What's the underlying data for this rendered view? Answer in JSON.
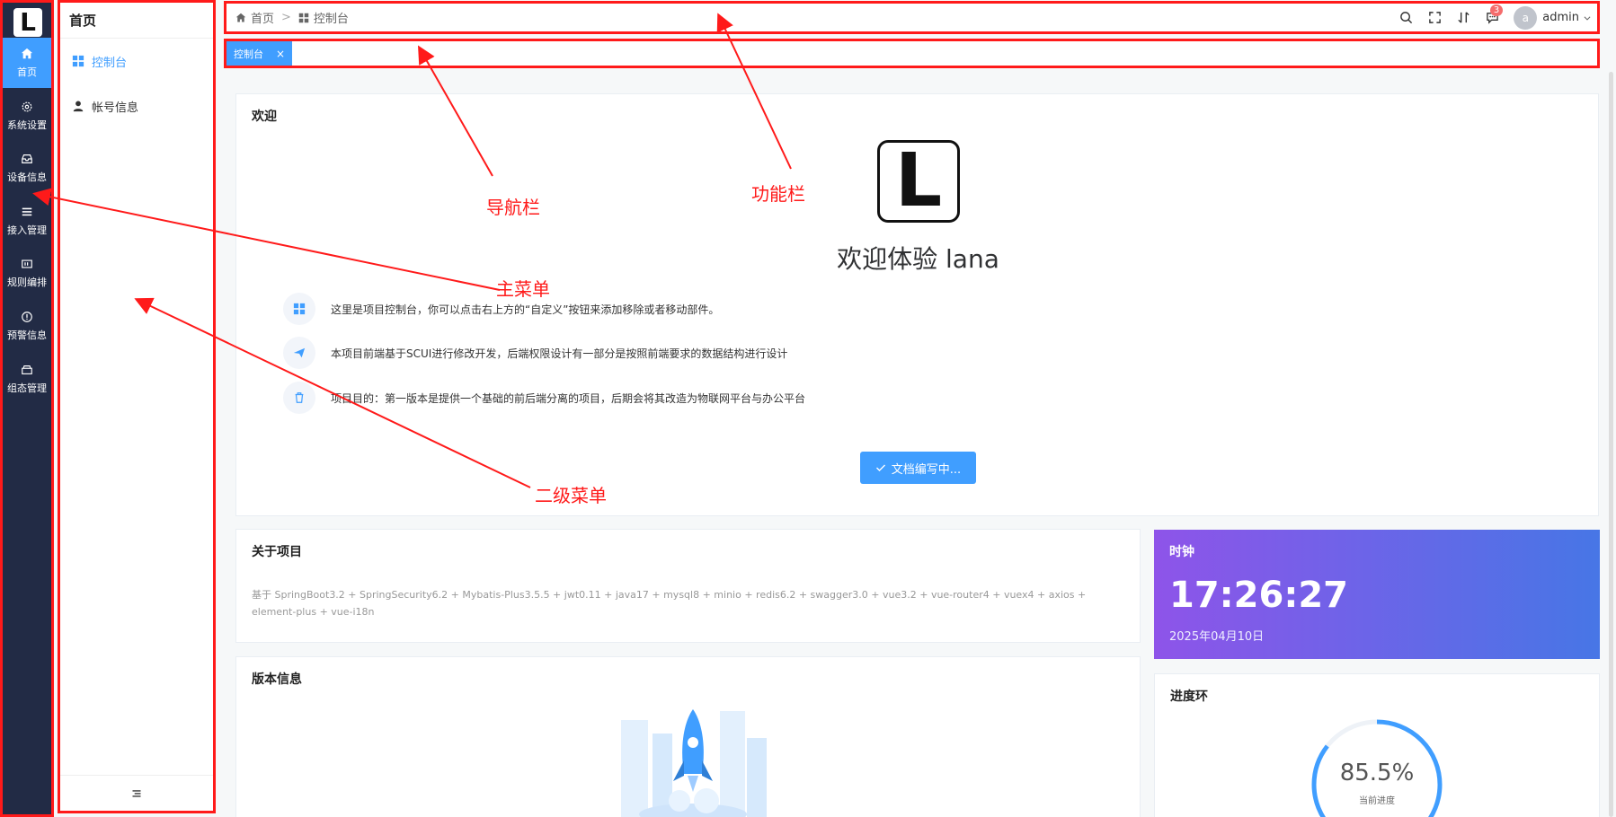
{
  "main_menu": {
    "logo_letter": "L",
    "items": [
      {
        "label": "首页",
        "icon": "home-icon",
        "active": true
      },
      {
        "label": "系统设置",
        "icon": "gear-icon"
      },
      {
        "label": "设备信息",
        "icon": "inbox-icon"
      },
      {
        "label": "接入管理",
        "icon": "list-icon"
      },
      {
        "label": "规则编排",
        "icon": "rule-icon"
      },
      {
        "label": "预警信息",
        "icon": "warning-icon"
      },
      {
        "label": "组态管理",
        "icon": "box-icon"
      }
    ]
  },
  "sub_menu": {
    "title": "首页",
    "items": [
      {
        "label": "控制台",
        "icon": "grid-icon",
        "active": true
      },
      {
        "label": "帐号信息",
        "icon": "user-icon"
      }
    ],
    "collapse_icon": "collapse-icon"
  },
  "header": {
    "breadcrumb": [
      {
        "label": "首页",
        "icon": "home-icon"
      },
      {
        "label": "控制台",
        "icon": "grid-icon"
      }
    ],
    "tools": [
      "search-icon",
      "fullscreen-icon",
      "sort-icon",
      "message-icon"
    ],
    "message_badge": "3",
    "user_initial": "a",
    "user_name": "admin"
  },
  "tabs": [
    {
      "label": "控制台",
      "close": "×"
    }
  ],
  "welcome": {
    "title": "欢迎",
    "logo_letter": "L",
    "heading": "欢迎体验 lana",
    "tips": [
      {
        "icon": "grid-icon",
        "text": "这里是项目控制台，你可以点击右上方的“自定义”按钮来添加移除或者移动部件。"
      },
      {
        "icon": "send-icon",
        "text": "本项目前端基于SCUI进行修改开发，后端权限设计有一部分是按照前端要求的数据结构进行设计"
      },
      {
        "icon": "trash-icon",
        "text": "项目目的：第一版本是提供一个基础的前后端分离的项目，后期会将其改造为物联网平台与办公平台"
      }
    ],
    "button": "文档编写中..."
  },
  "about": {
    "title": "关于项目",
    "text": "基于 SpringBoot3.2 + SpringSecurity6.2 + Mybatis-Plus3.5.5 + jwt0.11 + java17 + mysql8 + minio + redis6.2 + swagger3.0 + vue3.2 + vue-router4 + vuex4 + axios + element-plus + vue-i18n"
  },
  "version": {
    "title": "版本信息"
  },
  "clock": {
    "title": "时钟",
    "time": "17:26:27",
    "date": "2025年04月10日",
    "gradient": [
      "#8e54e9",
      "#4776e6"
    ]
  },
  "progress": {
    "title": "进度环",
    "value_text": "85.5%",
    "value": 85.5,
    "label": "当前进度",
    "color": "#409eff"
  },
  "annotations": {
    "nav": "导航栏",
    "func": "功能栏",
    "main": "主菜单",
    "sub": "二级菜单",
    "color": "#ff1a1a"
  }
}
